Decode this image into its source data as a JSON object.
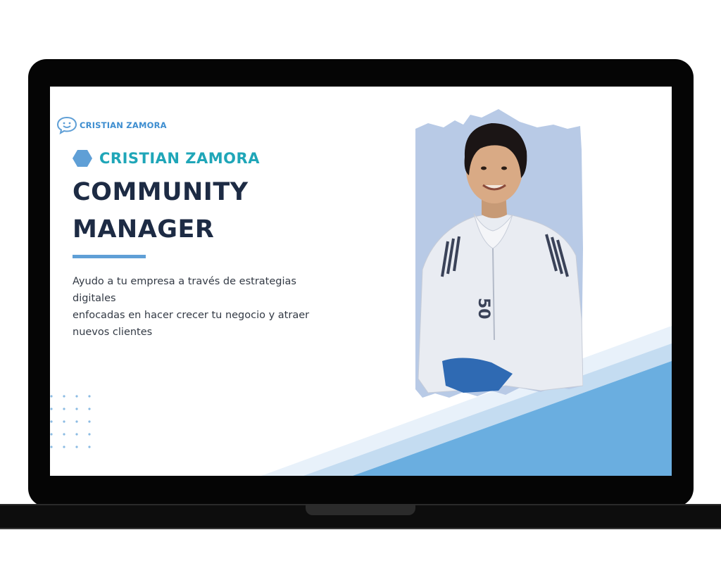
{
  "brand": {
    "logo_text": "CRISTIAN ZAMORA"
  },
  "hero": {
    "name": "CRISTIAN ZAMORA",
    "title_line1": "COMMUNITY",
    "title_line2": "MANAGER",
    "tagline_line1": "Ayudo a tu empresa a través de estrategias digitales",
    "tagline_line2": "enfocadas en hacer crecer tu negocio y atraer",
    "tagline_line3": "nuevos clientes"
  },
  "colors": {
    "accent": "#5f9fd6",
    "name_teal": "#1fa6b8",
    "heading": "#1d2b44",
    "photo_backdrop": "#b8cae6",
    "diagonal": "#6aaee0"
  },
  "icons": {
    "logo": "speech-bubble-smile-icon",
    "bullet": "hexagon-icon"
  }
}
